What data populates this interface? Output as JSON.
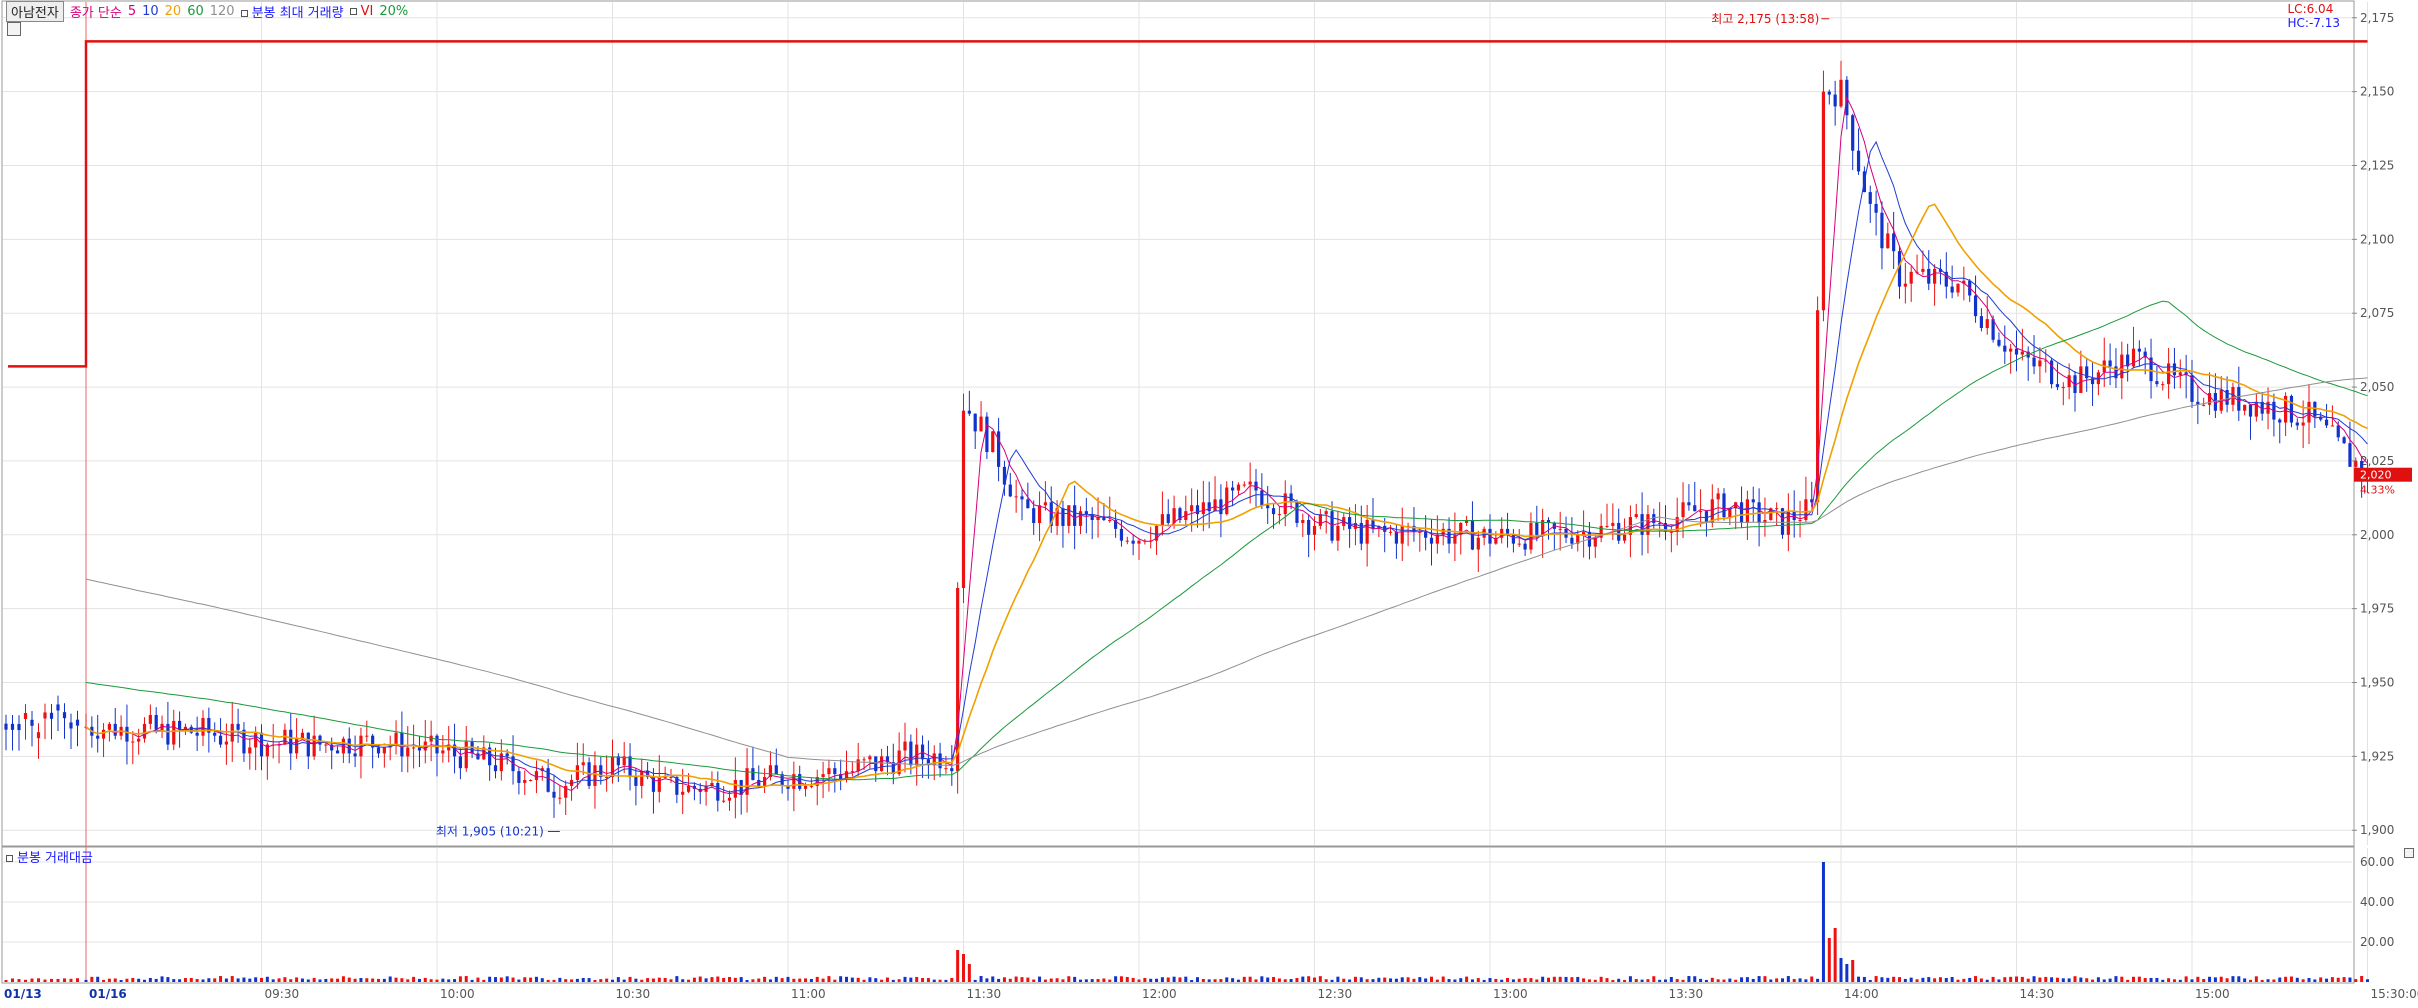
{
  "legend": {
    "title": "아남전자",
    "ma_label": "종가 단순",
    "ma_periods": [
      "5",
      "10",
      "20",
      "60",
      "120"
    ],
    "ma_colors": [
      "#d6007a",
      "#1f3bd6",
      "#f0a000",
      "#1a9a3a",
      "#909090"
    ],
    "extra_label": "분봉 최대 거래량",
    "vi_label": "VI",
    "vi_pct": "20%"
  },
  "right_info": {
    "lc": "LC:6.04",
    "hc": "HC:-7.13"
  },
  "price_badge": {
    "value": "2,020",
    "pct": "4.33%"
  },
  "annotations": {
    "high": "최고 2,175 (13:58)",
    "low": "최저 1,905 (10:21)"
  },
  "sub_panel": {
    "title": "분봉 거래대금"
  },
  "colors": {
    "up": "#ee1111",
    "down": "#1133cc",
    "vi_line": "#e01010",
    "grid": "#e3e3e3"
  },
  "chart_data": [
    {
      "type": "candlestick",
      "title": "아남전자",
      "y_ticks": [
        "1,900",
        "1,925",
        "1,950",
        "1,975",
        "2,000",
        "2,025",
        "2,050",
        "2,075",
        "2,100",
        "2,125",
        "2,150",
        "2,175"
      ],
      "ylim": [
        1895,
        2180
      ],
      "x_ticks": [
        "01/13",
        "01/16",
        "09:30",
        "10:00",
        "10:30",
        "11:00",
        "11:30",
        "12:00",
        "12:30",
        "13:00",
        "13:30",
        "14:00",
        "14:30",
        "15:00",
        "15:30:00"
      ],
      "vi_line": [
        {
          "t": "01/13",
          "v": 2057
        },
        {
          "t": "01/16 09:00",
          "v": 2057
        },
        {
          "t": "01/16 09:00",
          "v": 2167
        },
        {
          "t": "15:30",
          "v": 2167
        }
      ],
      "close_path": [
        [
          "09:00",
          1935
        ],
        [
          "09:10",
          1934
        ],
        [
          "09:20",
          1933
        ],
        [
          "09:30",
          1930
        ],
        [
          "09:40",
          1929
        ],
        [
          "09:50",
          1930
        ],
        [
          "10:00",
          1927
        ],
        [
          "10:10",
          1923
        ],
        [
          "10:20",
          1915
        ],
        [
          "10:30",
          1922
        ],
        [
          "10:40",
          1914
        ],
        [
          "10:50",
          1915
        ],
        [
          "11:00",
          1918
        ],
        [
          "11:10",
          1920
        ],
        [
          "11:20",
          1925
        ],
        [
          "11:28",
          1925
        ],
        [
          "11:30",
          2045
        ],
        [
          "11:35",
          2030
        ],
        [
          "11:40",
          2008
        ],
        [
          "11:50",
          2005
        ],
        [
          "12:00",
          2000
        ],
        [
          "12:10",
          2008
        ],
        [
          "12:20",
          2015
        ],
        [
          "12:30",
          2004
        ],
        [
          "12:40",
          2000
        ],
        [
          "12:50",
          2001
        ],
        [
          "13:00",
          1999
        ],
        [
          "13:10",
          2000
        ],
        [
          "13:20",
          2002
        ],
        [
          "13:30",
          2005
        ],
        [
          "13:40",
          2010
        ],
        [
          "13:50",
          2004
        ],
        [
          "13:55",
          2009
        ],
        [
          "13:57",
          2150
        ],
        [
          "14:00",
          2150
        ],
        [
          "14:05",
          2110
        ],
        [
          "14:10",
          2088
        ],
        [
          "14:20",
          2085
        ],
        [
          "14:30",
          2060
        ],
        [
          "14:40",
          2052
        ],
        [
          "14:50",
          2060
        ],
        [
          "15:00",
          2048
        ],
        [
          "15:10",
          2045
        ],
        [
          "15:20",
          2040
        ],
        [
          "15:30",
          2020
        ]
      ],
      "annotations": [
        {
          "label": "최고 2,175 (13:58)",
          "t": "13:58",
          "v": 2175
        },
        {
          "label": "최저 1,905 (10:21)",
          "t": "10:21",
          "v": 1905
        }
      ]
    },
    {
      "type": "bar",
      "title": "분봉 거래대금",
      "y_ticks": [
        "20.00",
        "40.00",
        "60.00"
      ],
      "ylim": [
        0,
        65
      ],
      "spikes": [
        {
          "t": "11:29",
          "v": 16
        },
        {
          "t": "11:30",
          "v": 14
        },
        {
          "t": "11:31",
          "v": 9
        },
        {
          "t": "13:57",
          "v": 60
        },
        {
          "t": "13:58",
          "v": 22
        },
        {
          "t": "13:59",
          "v": 27
        },
        {
          "t": "14:00",
          "v": 12
        },
        {
          "t": "14:01",
          "v": 9
        },
        {
          "t": "14:02",
          "v": 11
        }
      ]
    }
  ]
}
